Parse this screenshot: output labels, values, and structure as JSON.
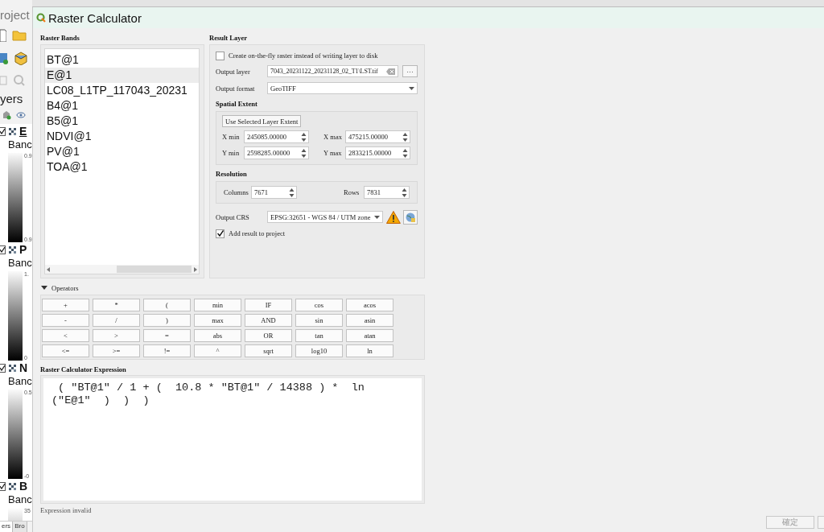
{
  "background_window": {
    "title": "roject",
    "panel_title": "yers",
    "layers": [
      {
        "name": "E",
        "checked": true,
        "label": "Banc",
        "ticks": [
          "0.9",
          "0.9"
        ]
      },
      {
        "name": "P",
        "checked": true,
        "label": "Banc",
        "ticks": [
          "1.",
          "0"
        ]
      },
      {
        "name": "N",
        "checked": true,
        "label": "Banc",
        "ticks": [
          "0.5",
          "-0"
        ]
      },
      {
        "name": "B",
        "checked": true,
        "label": "Banc",
        "ticks": [
          "35"
        ]
      }
    ],
    "tabs": [
      {
        "label": "ers",
        "selected": true
      },
      {
        "label": "Bro",
        "selected": false
      }
    ]
  },
  "dialog": {
    "title": "Raster Calculator",
    "raster_bands": {
      "label": "Raster Bands",
      "items": [
        {
          "label": "BT@1",
          "selected": false
        },
        {
          "label": "E@1",
          "selected": true
        },
        {
          "label": "LC08_L1TP_117043_20231",
          "selected": false
        },
        {
          "label": "B4@1",
          "selected": false
        },
        {
          "label": "B5@1",
          "selected": false
        },
        {
          "label": "NDVI@1",
          "selected": false
        },
        {
          "label": "PV@1",
          "selected": false
        },
        {
          "label": "TOA@1",
          "selected": false
        }
      ]
    },
    "result_layer": {
      "label": "Result Layer",
      "on_the_fly": {
        "label": "Create on-the-fly raster instead of writing layer to disk",
        "checked": false
      },
      "output_layer": {
        "label": "Output layer",
        "value": "7043_20231122_20231128_02_T1\\LST.tif",
        "browse": "···"
      },
      "output_format": {
        "label": "Output format",
        "value": "GeoTIFF"
      },
      "spatial_extent": {
        "label": "Spatial Extent",
        "button": "Use Selected Layer Extent",
        "fields": [
          {
            "label": "X min",
            "value": "245085.00000"
          },
          {
            "label": "X max",
            "value": "475215.00000"
          },
          {
            "label": "Y min",
            "value": "2598285.00000"
          },
          {
            "label": "Y max",
            "value": "2833215.00000"
          }
        ]
      },
      "resolution": {
        "label": "Resolution",
        "fields": [
          {
            "label": "Columns",
            "value": "7671"
          },
          {
            "label": "Rows",
            "value": "7831"
          }
        ]
      },
      "output_crs": {
        "label": "Output CRS",
        "value": "EPSG:32651 - WGS 84 / UTM zone"
      },
      "add_to_project": {
        "label": "Add result to project",
        "checked": true
      }
    },
    "operators": {
      "label": "Operators",
      "expanded": true,
      "buttons": [
        "+",
        "*",
        "(",
        "min",
        "IF",
        "cos",
        "acos",
        "-",
        "/",
        ")",
        "max",
        "AND",
        "sin",
        "asin",
        "<",
        ">",
        "=",
        "abs",
        "OR",
        "tan",
        "atan",
        "<=",
        ">=",
        "!=",
        "^",
        "sqrt",
        "log10",
        "ln"
      ]
    },
    "expression": {
      "label": "Raster Calculator Expression",
      "value": " ( \"BT@1\" / 1 + (  10.8 * \"BT@1\" / 14388 ) *  ln (\"E@1\"  )  )  )"
    },
    "status": "Expression invalid",
    "buttons": [
      {
        "kind": "full",
        "label": "確定"
      },
      {
        "kind": "clipped"
      }
    ]
  }
}
